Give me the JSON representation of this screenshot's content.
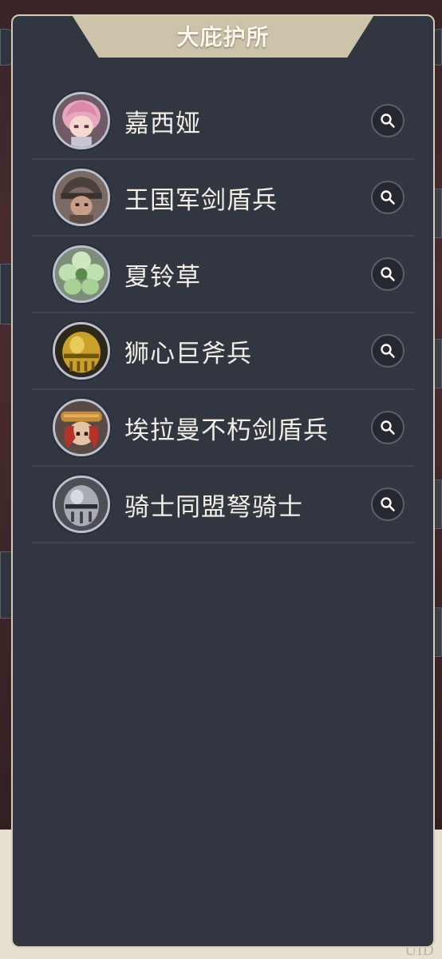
{
  "panel": {
    "title": "大庇护所"
  },
  "background": {
    "uid_label": "UID"
  },
  "units": [
    {
      "name": "嘉西娅",
      "icon": "pink-hair-girl-portrait"
    },
    {
      "name": "王国军剑盾兵",
      "icon": "hooded-soldier-portrait"
    },
    {
      "name": "夏铃草",
      "icon": "green-flower-portrait"
    },
    {
      "name": "狮心巨斧兵",
      "icon": "golden-helmet-portrait"
    },
    {
      "name": "埃拉曼不朽剑盾兵",
      "icon": "red-hair-hat-soldier-portrait"
    },
    {
      "name": "骑士同盟弩骑士",
      "icon": "steel-helmet-knight-portrait"
    }
  ],
  "colors": {
    "panel_bg": "#323640",
    "panel_border": "#d6cbb4",
    "title_tab": "#ccc3aa",
    "row_divider": "#41464f",
    "text": "#f1eee6"
  }
}
